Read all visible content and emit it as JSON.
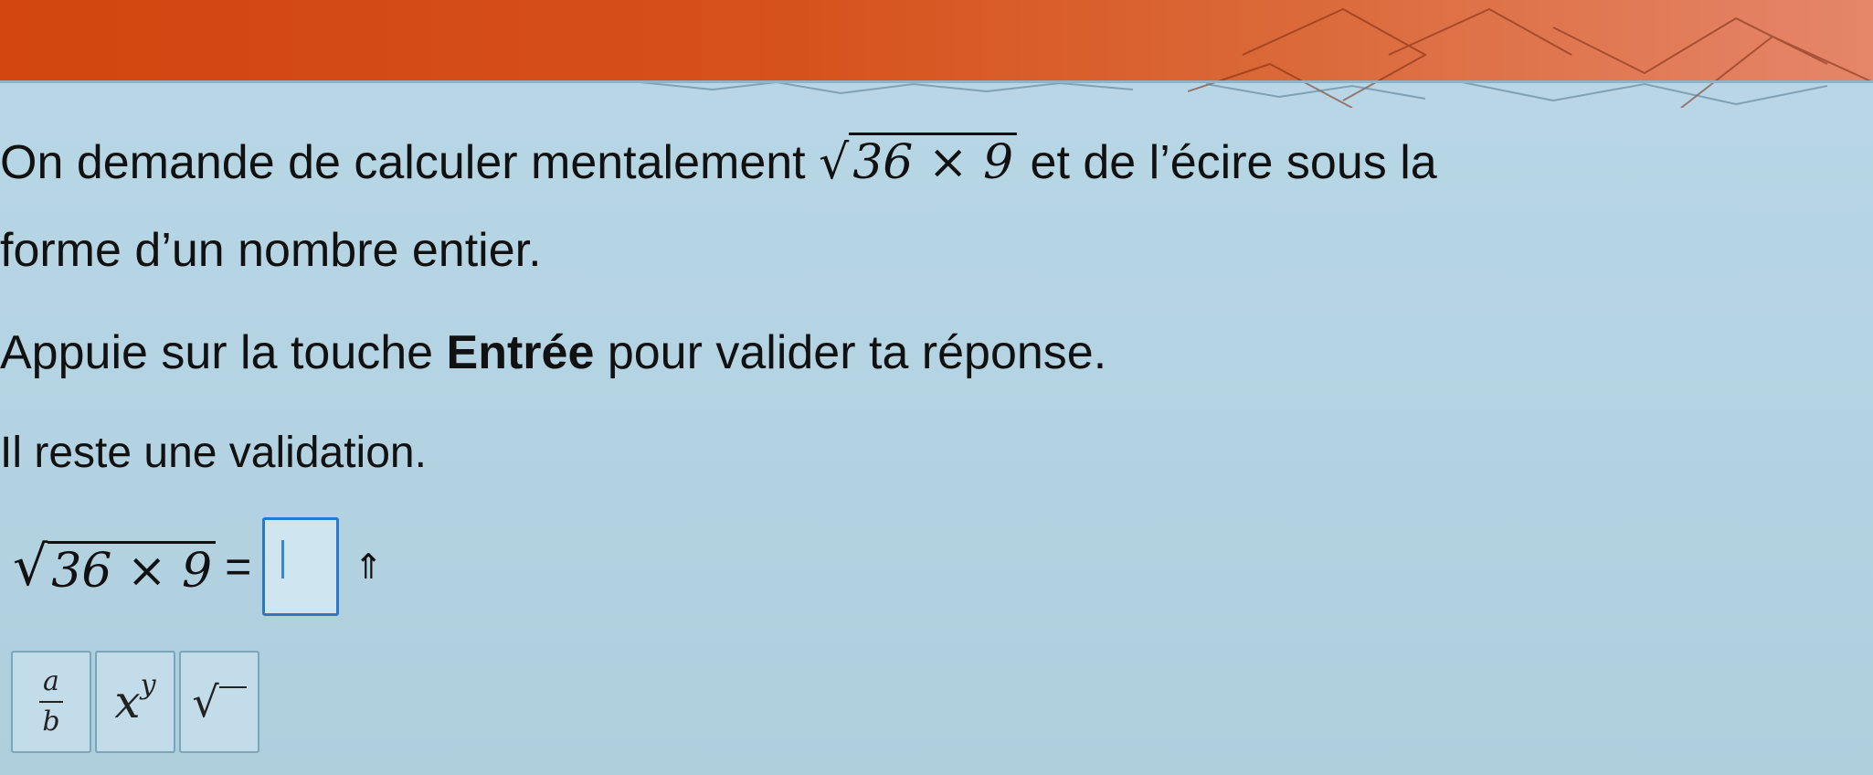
{
  "header": {
    "accent_color": "#d2450f"
  },
  "exercise": {
    "line1_prefix": "On demande de calculer mentalement ",
    "expression_radicand": "36 × 9",
    "radical": "√",
    "line1_suffix": " et de l’écire sous la",
    "line2": "forme d’un nombre entier.",
    "instruction_prefix": "Appuie sur la touche ",
    "instruction_key": "Entrée",
    "instruction_suffix": " pour valider ta réponse.",
    "remaining": "Il reste une validation."
  },
  "answer": {
    "equals": "=",
    "value": "",
    "shift_symbol": "⇑"
  },
  "palette": {
    "fraction_num": "a",
    "fraction_den": "b",
    "power_base": "x",
    "power_exp": "y",
    "sqrt_symbol": "√"
  }
}
